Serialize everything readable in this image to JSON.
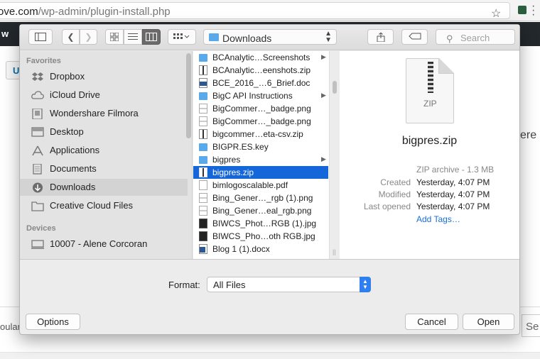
{
  "browser": {
    "url_host": "ove.com",
    "url_path": "/wp-admin/plugin-install.php",
    "star_icon": "star-icon"
  },
  "background": {
    "admin_bar_text": "w",
    "upload_button_text": "U",
    "right_text": "ere",
    "popular_text": "oular",
    "search_partial": "Se"
  },
  "dialog": {
    "toolbar": {
      "location": "Downloads",
      "search_placeholder": "Search"
    },
    "sidebar": {
      "favorites_header": "Favorites",
      "favorites": [
        {
          "label": "Dropbox",
          "icon": "dropbox-icon"
        },
        {
          "label": "iCloud Drive",
          "icon": "cloud-icon"
        },
        {
          "label": "Wondershare Filmora",
          "icon": "app-icon"
        },
        {
          "label": "Desktop",
          "icon": "desktop-icon"
        },
        {
          "label": "Applications",
          "icon": "applications-icon"
        },
        {
          "label": "Documents",
          "icon": "documents-icon"
        },
        {
          "label": "Downloads",
          "icon": "downloads-icon",
          "selected": true
        },
        {
          "label": "Creative Cloud Files",
          "icon": "folder-icon"
        }
      ],
      "devices_header": "Devices",
      "devices": [
        {
          "label": "10007 - Alene Corcoran",
          "icon": "computer-icon"
        }
      ]
    },
    "files": [
      {
        "name": "BCAnalytic…Screenshots",
        "type": "folder",
        "chevron": true
      },
      {
        "name": "BCAnalytic…eenshots.zip",
        "type": "zip"
      },
      {
        "name": "BCE_2016_…6_Brief.doc",
        "type": "doc"
      },
      {
        "name": "BigC API Instructions",
        "type": "folder",
        "chevron": true
      },
      {
        "name": "BigCommer…_badge.png",
        "type": "image"
      },
      {
        "name": "BigCommer…_badge.png",
        "type": "image"
      },
      {
        "name": "bigcommer…eta-csv.zip",
        "type": "zip"
      },
      {
        "name": "BIGPR.ES.key",
        "type": "key"
      },
      {
        "name": "bigpres",
        "type": "folder",
        "chevron": true
      },
      {
        "name": "bigpres.zip",
        "type": "zip",
        "selected": true
      },
      {
        "name": "bimlogoscalable.pdf",
        "type": "pdf"
      },
      {
        "name": "Bing_Gener…_rgb (1).png",
        "type": "image"
      },
      {
        "name": "Bing_Gener…eal_rgb.png",
        "type": "image"
      },
      {
        "name": "BIWCS_Phot…RGB (1).jpg",
        "type": "jpg"
      },
      {
        "name": "BIWCS_Pho…oth RGB.jpg",
        "type": "jpg"
      },
      {
        "name": "Blog 1 (1).docx",
        "type": "word"
      }
    ],
    "preview": {
      "icon_label": "ZIP",
      "filename": "bigpres.zip",
      "kind": "ZIP archive - 1.3 MB",
      "created_label": "Created",
      "created": "Yesterday, 4:07 PM",
      "modified_label": "Modified",
      "modified": "Yesterday, 4:07 PM",
      "last_opened_label": "Last opened",
      "last_opened": "Yesterday, 4:07 PM",
      "add_tags": "Add Tags…"
    },
    "format_label": "Format:",
    "format_value": "All Files",
    "options_label": "Options",
    "cancel_label": "Cancel",
    "open_label": "Open"
  },
  "colors": {
    "selection": "#1566d8",
    "folder": "#5aa9ea",
    "link": "#1a6fd8"
  }
}
